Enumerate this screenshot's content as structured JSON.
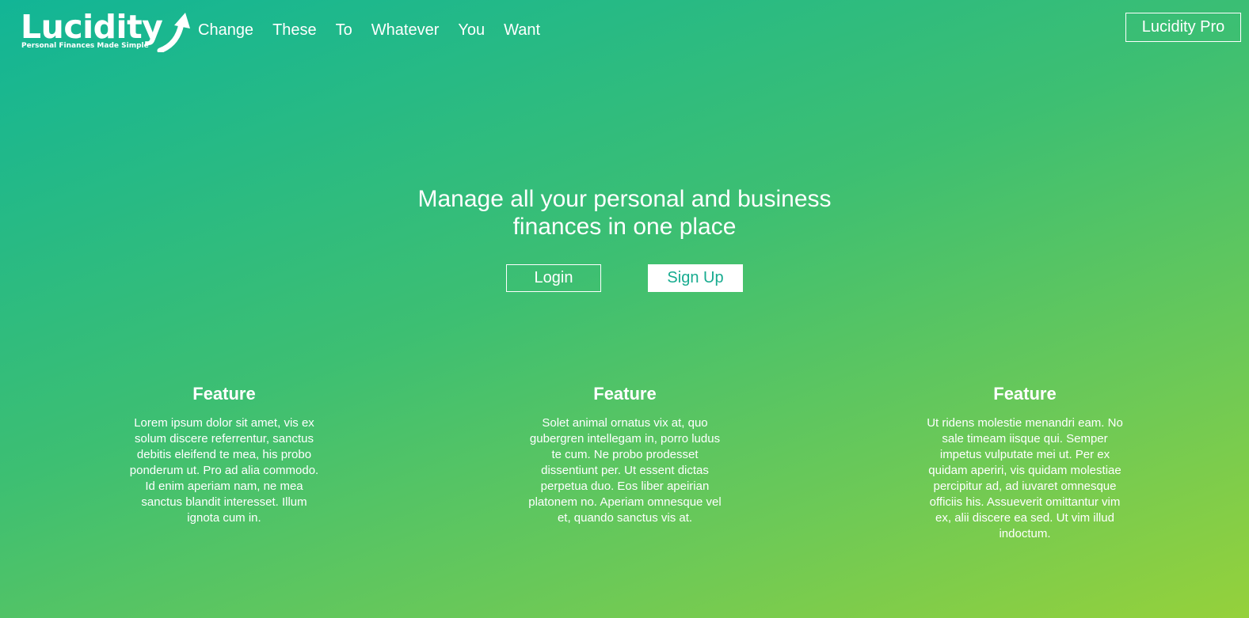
{
  "brand": {
    "name": "Lucidity",
    "tagline": "Personal Finances Made Simple"
  },
  "nav": {
    "links": [
      "Change",
      "These",
      "To",
      "Whatever",
      "You",
      "Want"
    ],
    "pro_label": "Lucidity Pro"
  },
  "hero": {
    "title": "Manage all your personal and business finances in one place",
    "login_label": "Login",
    "signup_label": "Sign Up"
  },
  "features": [
    {
      "title": "Feature",
      "text": "Lorem ipsum dolor sit amet, vis ex solum discere referrentur, sanctus debitis eleifend te mea, his probo ponderum ut. Pro ad alia commodo. Id enim aperiam nam, ne mea sanctus blandit interesset. Illum ignota cum in."
    },
    {
      "title": "Feature",
      "text": "Solet animal ornatus vix at, quo gubergren intellegam in, porro ludus te cum. Ne probo prodesset dissentiunt per. Ut essent dictas perpetua duo. Eos liber apeirian platonem no. Aperiam omnesque vel et, quando sanctus vis at."
    },
    {
      "title": "Feature",
      "text": "Ut ridens molestie menandri eam. No sale timeam iisque qui. Semper impetus vulputate mei ut. Per ex quidam aperiri, vis quidam molestiae percipitur ad, ad iuvaret omnesque officiis his. Assueverit omittantur vim ex, alii discere ea sed. Ut vim illud indoctum."
    }
  ],
  "colors": {
    "gradient_start": "#12b596",
    "gradient_end": "#95d13b",
    "signup_text": "#17ab8f",
    "text": "#ffffff"
  },
  "icons": {
    "logo_mark": "upward-arrow-icon"
  }
}
